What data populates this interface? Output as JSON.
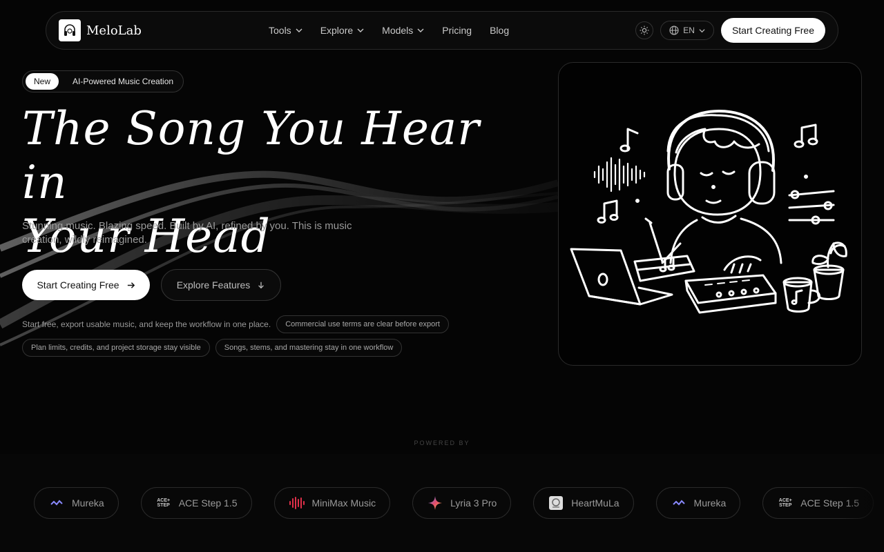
{
  "brand": {
    "name": "MeloLab"
  },
  "nav": {
    "links": [
      {
        "label": "Tools",
        "dropdown": true
      },
      {
        "label": "Explore",
        "dropdown": true
      },
      {
        "label": "Models",
        "dropdown": true
      },
      {
        "label": "Pricing",
        "dropdown": false
      },
      {
        "label": "Blog",
        "dropdown": false
      }
    ],
    "language": "EN",
    "cta": "Start Creating Free"
  },
  "hero": {
    "badge_new": "New",
    "badge_text": "AI-Powered Music Creation",
    "title_line1": "The Song You Hear in",
    "title_line2": "Your Head",
    "subtitle": "Stunning music. Blazing speed. Built by AI, refined by you. This is music creation, wildly reimagined.",
    "primary_cta": "Start Creating Free",
    "secondary_cta": "Explore Features",
    "info_text": "Start free, export usable music, and keep the workflow in one place.",
    "pills": [
      "Commercial use terms are clear before export",
      "Plan limits, credits, and project storage stay visible",
      "Songs, stems, and mastering stay in one workflow"
    ]
  },
  "powered": {
    "label": "POWERED BY",
    "models": [
      "Mureka",
      "ACE Step 1.5",
      "MiniMax Music",
      "Lyria 3 Pro",
      "HeartMuLa",
      "Mureka",
      "ACE Step 1.5"
    ]
  },
  "icons": {
    "theme": "sun-icon",
    "language": "globe-icon",
    "dropdown": "chevron-down-icon",
    "primary_arrow": "arrow-right-icon",
    "secondary_arrow": "arrow-down-icon"
  }
}
